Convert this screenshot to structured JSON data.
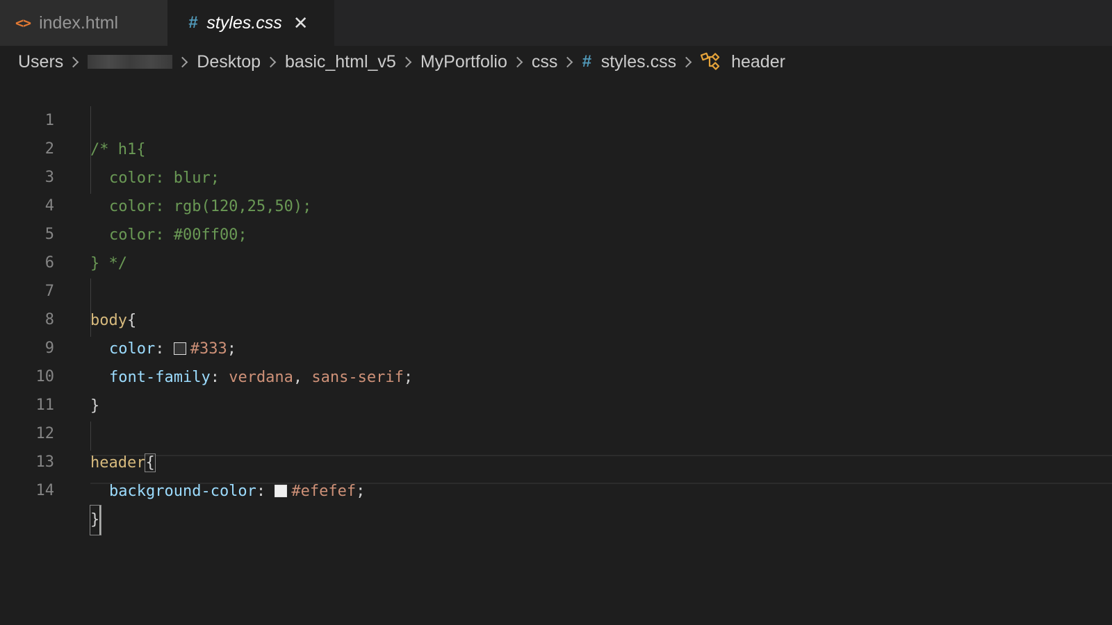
{
  "tabs": [
    {
      "label": "index.html",
      "icon": "html-file-icon",
      "active": false
    },
    {
      "label": "styles.css",
      "icon": "css-file-icon",
      "active": true
    }
  ],
  "tab_close_glyph": "✕",
  "breadcrumb": {
    "items": [
      "Users",
      "Desktop",
      "basic_html_v5",
      "MyPortfolio",
      "css",
      "styles.css",
      "header"
    ],
    "hash_glyph": "#",
    "icon_file": "css-file-icon",
    "icon_symbol": "symbol-class-icon"
  },
  "colors": {
    "comment": "#6a9955",
    "selector": "#d7ba7d",
    "property": "#9cdcfe",
    "value": "#ce9178",
    "swatch_333": "#333333",
    "swatch_efefef": "#efefef",
    "css_icon": "#519aba",
    "html_icon": "#e37933",
    "symbol_icon": "#e5a33a"
  },
  "editor": {
    "line_numbers": [
      "1",
      "2",
      "3",
      "4",
      "5",
      "6",
      "7",
      "8",
      "9",
      "10",
      "11",
      "12",
      "13",
      "14"
    ],
    "line1": "/* h1{",
    "line2": "color: blur;",
    "line3": "color: rgb(120,25,50);",
    "line4": "color: #00ff00;",
    "line5": "} */",
    "line7_selector": "body",
    "line7_brace": "{",
    "line8_prop": "color",
    "line8_colon": ": ",
    "line8_value": "#333",
    "line8_semi": ";",
    "line9_prop": "font-family",
    "line9_colon": ": ",
    "line9_value1": "verdana",
    "line9_comma": ", ",
    "line9_value2": "sans-serif",
    "line9_semi": ";",
    "line10": "}",
    "line12_selector": "header",
    "line12_brace": "{",
    "line13_prop": "background-color",
    "line13_colon": ": ",
    "line13_value": "#efefef",
    "line13_semi": ";",
    "line14": "}"
  }
}
